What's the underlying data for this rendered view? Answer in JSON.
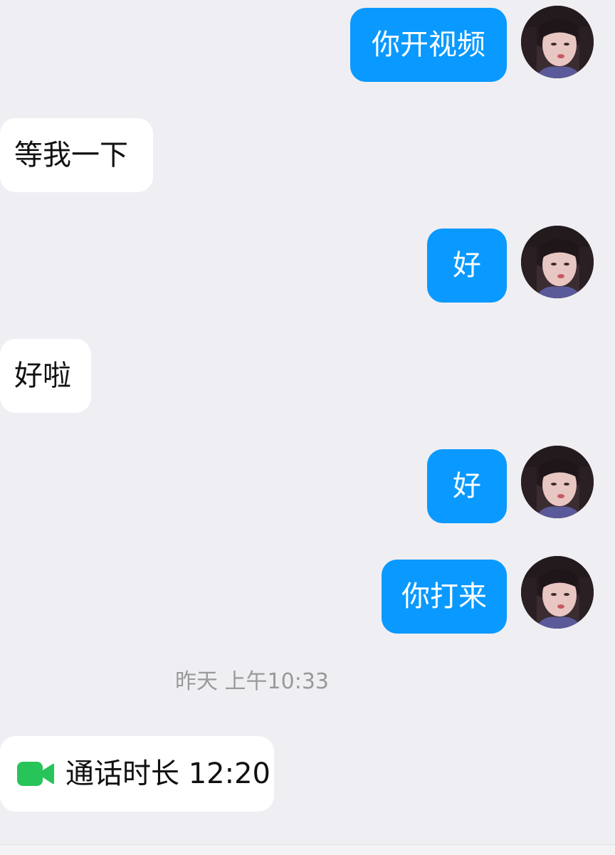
{
  "messages": [
    {
      "side": "out",
      "text": "你开视频"
    },
    {
      "side": "in",
      "text": "等我一下"
    },
    {
      "side": "out",
      "text": "好"
    },
    {
      "side": "in",
      "text": "好啦"
    },
    {
      "side": "out",
      "text": "好"
    },
    {
      "side": "out",
      "text": "你打来"
    }
  ],
  "timestamp": "昨天 上午10:33",
  "call_record": {
    "icon": "video-call-icon",
    "text": "通话时长 12:20",
    "icon_color": "#27c45a"
  },
  "colors": {
    "outgoing_bubble": "#0a99ff",
    "incoming_bubble": "#ffffff",
    "background": "#efeff3",
    "timestamp_text": "#999999"
  }
}
